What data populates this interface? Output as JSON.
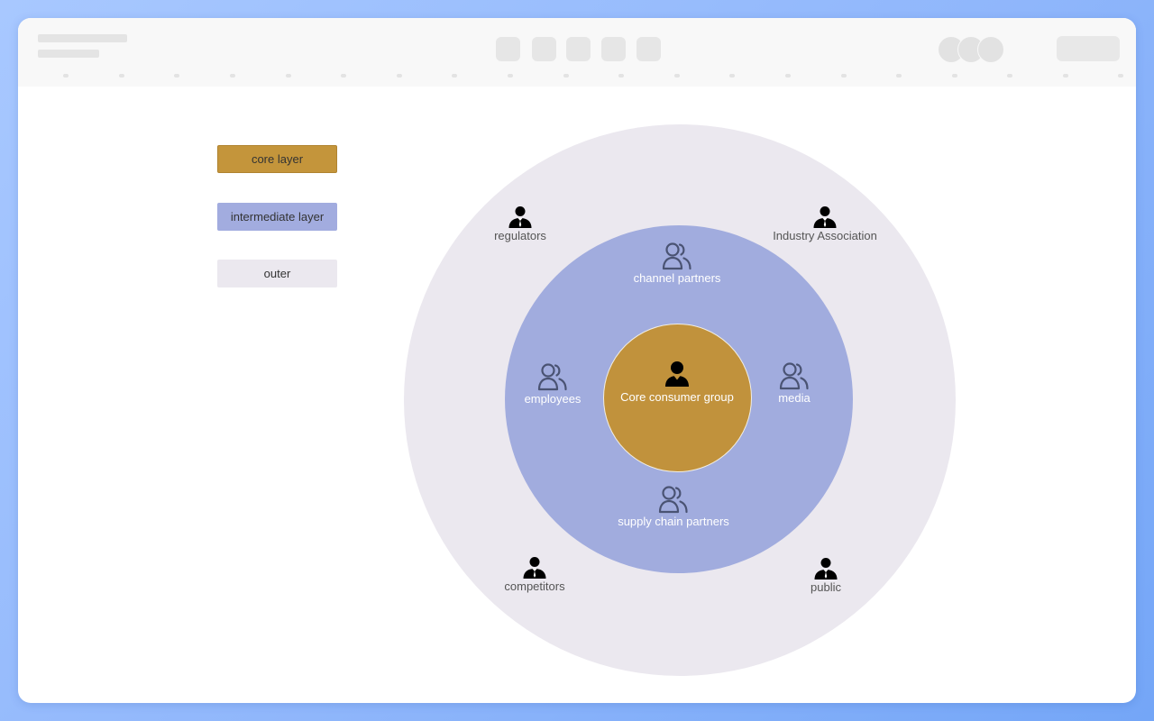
{
  "colors": {
    "core": "#c1923c",
    "intermediate": "#a1acde",
    "outer": "#ebe8ef",
    "background": "#8fb6fb"
  },
  "legend": {
    "core_label": "core layer",
    "intermediate_label": "intermediate layer",
    "outer_label": "outer"
  },
  "diagram": {
    "core": {
      "label": "Core consumer group",
      "icon": "person-icon"
    },
    "intermediate": [
      {
        "label": "channel partners",
        "icon": "user-group-icon"
      },
      {
        "label": "employees",
        "icon": "user-group-icon"
      },
      {
        "label": "media",
        "icon": "user-group-icon"
      },
      {
        "label": "supply chain partners",
        "icon": "user-group-icon"
      }
    ],
    "outer": [
      {
        "label": "regulators",
        "icon": "business-person-icon"
      },
      {
        "label": "Industry Association",
        "icon": "business-person-icon"
      },
      {
        "label": "competitors",
        "icon": "business-person-icon"
      },
      {
        "label": "public",
        "icon": "business-person-icon"
      }
    ]
  }
}
